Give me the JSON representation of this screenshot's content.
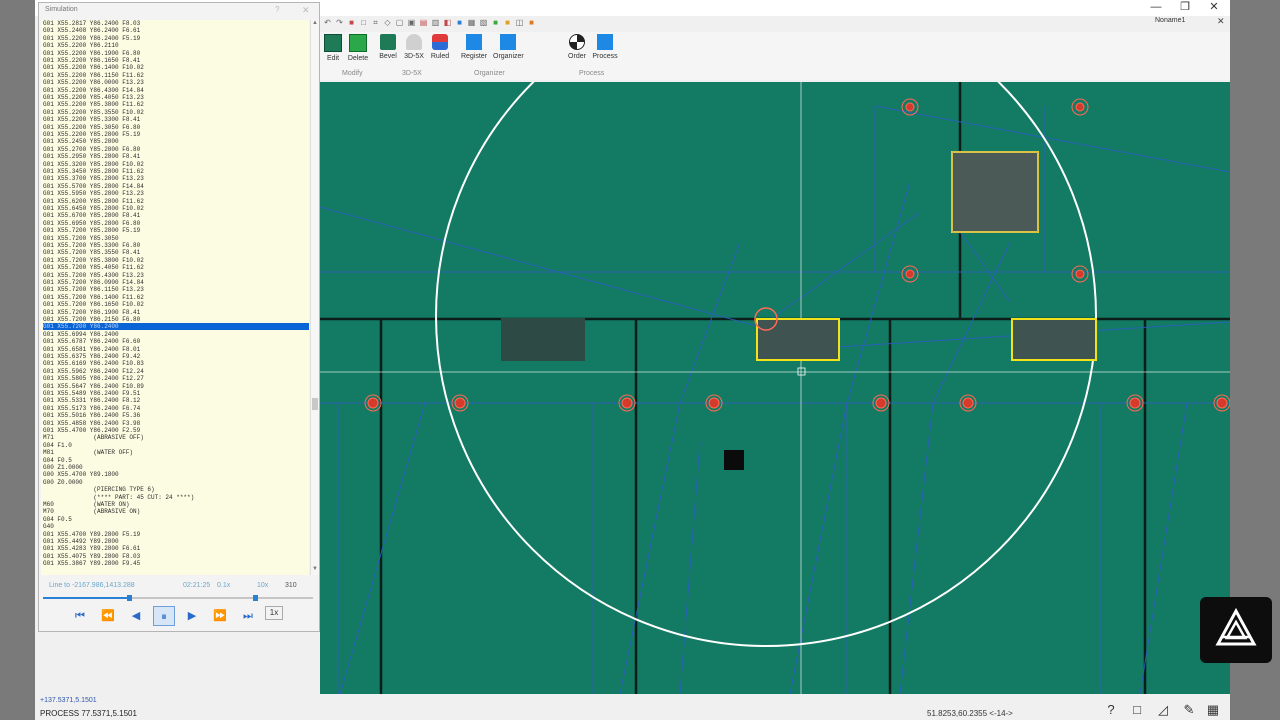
{
  "app": {
    "doc_name": "Noname1",
    "window_controls": {
      "minimize": "—",
      "restore": "❐",
      "close": "✕"
    }
  },
  "ribbon": {
    "groups": [
      {
        "name": "Modify",
        "buttons": [
          "Edit",
          "Delete"
        ]
      },
      {
        "name": "3D-5X",
        "buttons": [
          "Bevel",
          "3D-5X",
          "Ruled"
        ]
      },
      {
        "name": "Organizer",
        "buttons": [
          "Register",
          "Organizer"
        ]
      },
      {
        "name": "Process",
        "buttons": [
          "Order",
          "Process"
        ]
      }
    ]
  },
  "simulation": {
    "title": "Simulation",
    "help": "?",
    "close": "✕",
    "code_lines": [
      "G01 X55.2817 Y86.2400 F8.03",
      "G01 X55.2408 Y86.2400 F6.61",
      "G01 X55.2200 Y86.2400 F5.19",
      "G01 X55.2200 Y86.2110",
      "G01 X55.2200 Y86.1900 F6.80",
      "G01 X55.2200 Y86.1650 F8.41",
      "G01 X55.2200 Y86.1400 F10.02",
      "G01 X55.2200 Y86.1150 F11.62",
      "G01 X55.2200 Y86.0000 F13.23",
      "G01 X55.2200 Y86.4300 F14.84",
      "G01 X55.2200 Y85.4050 F13.23",
      "G01 X55.2200 Y85.3800 F11.62",
      "G01 X55.2200 Y85.3550 F10.02",
      "G01 X55.2200 Y85.3300 F8.41",
      "G01 X55.2200 Y85.3050 F6.80",
      "G01 X55.2200 Y85.2800 F5.19",
      "G01 X55.2450 Y85.2800",
      "G01 X55.2700 Y85.2800 F6.80",
      "G01 X55.2950 Y85.2800 F8.41",
      "G01 X55.3200 Y85.2800 F10.02",
      "G01 X55.3450 Y85.2800 F11.62",
      "G01 X55.3700 Y85.2800 F13.23",
      "G01 X55.5700 Y85.2800 F14.84",
      "G01 X55.5950 Y85.2800 F13.23",
      "G01 X55.6200 Y85.2800 F11.62",
      "G01 X55.6450 Y85.2800 F10.02",
      "G01 X55.6700 Y85.2800 F8.41",
      "G01 X55.6950 Y85.2800 F6.80",
      "G01 X55.7200 Y85.2800 F5.19",
      "G01 X55.7200 Y85.3050",
      "G01 X55.7200 Y85.3300 F6.80",
      "G01 X55.7200 Y85.3550 F8.41",
      "G01 X55.7200 Y85.3800 F10.02",
      "G01 X55.7200 Y85.4050 F11.62",
      "G01 X55.7200 Y85.4300 F13.23",
      "G01 X55.7200 Y86.0900 F14.84",
      "G01 X55.7200 Y86.1150 F13.23",
      "G01 X55.7200 Y86.1400 F11.62",
      "G01 X55.7200 Y86.1650 F10.02",
      "G01 X55.7200 Y86.1900 F8.41",
      "G01 X55.7200 Y86.2150 F6.80",
      "G01 X55.7200 Y86.2400",
      "G01 X55.6994 Y86.2400",
      "G01 X55.6787 Y86.2400 F6.60",
      "G01 X55.6581 Y86.2400 F8.01",
      "G01 X55.6375 Y86.2400 F9.42",
      "G01 X55.6169 Y86.2400 F10.83",
      "G01 X55.5962 Y86.2400 F12.24",
      "G01 X55.5805 Y86.2400 F12.27",
      "G01 X55.5647 Y86.2400 F10.89",
      "G01 X55.5489 Y86.2400 F9.51",
      "G01 X55.5331 Y86.2400 F8.12",
      "G01 X55.5173 Y86.2400 F6.74",
      "G01 X55.5016 Y86.2400 F5.36",
      "G01 X55.4858 Y86.2400 F3.98",
      "G01 X55.4700 Y86.2400 F2.59",
      "M71           (ABRASIVE OFF)",
      "G04 F1.0",
      "M81           (WATER OFF)",
      "G04 F0.5",
      "G00 Z1.0000",
      "G00 X55.4700 Y89.1800",
      "G00 Z0.0000",
      "              (PIERCING TYPE 6)",
      "              (**** PART: 45 CUT: 24 ****)",
      "M60           (WATER ON)",
      "M70           (ABRASIVE ON)",
      "G04 F0.5",
      "G40",
      "G01 X55.4700 Y89.2800 F5.19",
      "G01 X55.4492 Y89.2800",
      "G01 X55.4283 Y89.2800 F6.61",
      "G01 X55.4075 Y89.2800 F8.03",
      "G01 X55.3867 Y89.2800 F9.45"
    ],
    "selected_line_index": 41,
    "line_to": "Line to -2167.986,1413.288",
    "time": "02:21:25",
    "speed": "0.1x",
    "speed_max": "10x",
    "count": "310",
    "rate": "1x"
  },
  "status": {
    "coord_small": "+137.5371,5.1501",
    "process_label": "PROCESS  77.5371,5.1501",
    "coord_right": "51.8253,60.2355  <-14->"
  },
  "colors": {
    "canvas_bg": "#137a63",
    "selection": "#0a64d6",
    "code_bg": "#fcfce3",
    "pierce_red": "#e23b2a",
    "part_outline": "#f2e21a"
  }
}
